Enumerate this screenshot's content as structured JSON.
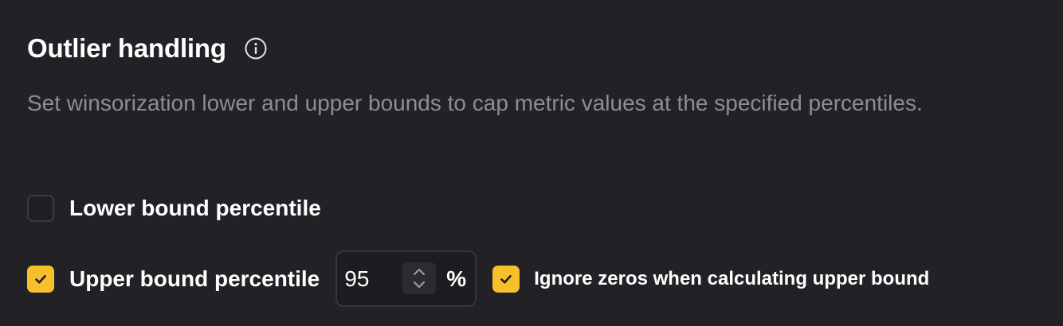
{
  "section": {
    "title": "Outlier handling",
    "description": "Set winsorization lower and upper bounds to cap metric values at the specified percentiles."
  },
  "lower_bound": {
    "label": "Lower bound percentile",
    "checked": false
  },
  "upper_bound": {
    "label": "Upper bound percentile",
    "checked": true,
    "value": "95",
    "unit": "%"
  },
  "ignore_zeros": {
    "label": "Ignore zeros when calculating upper bound",
    "checked": true
  },
  "icons": {
    "info": "info-icon",
    "check": "check-icon",
    "stepper": "chevron-up-down-icon"
  },
  "colors": {
    "background": "#222226",
    "accent": "#f6bf2c",
    "muted_text": "#8d8d93"
  }
}
